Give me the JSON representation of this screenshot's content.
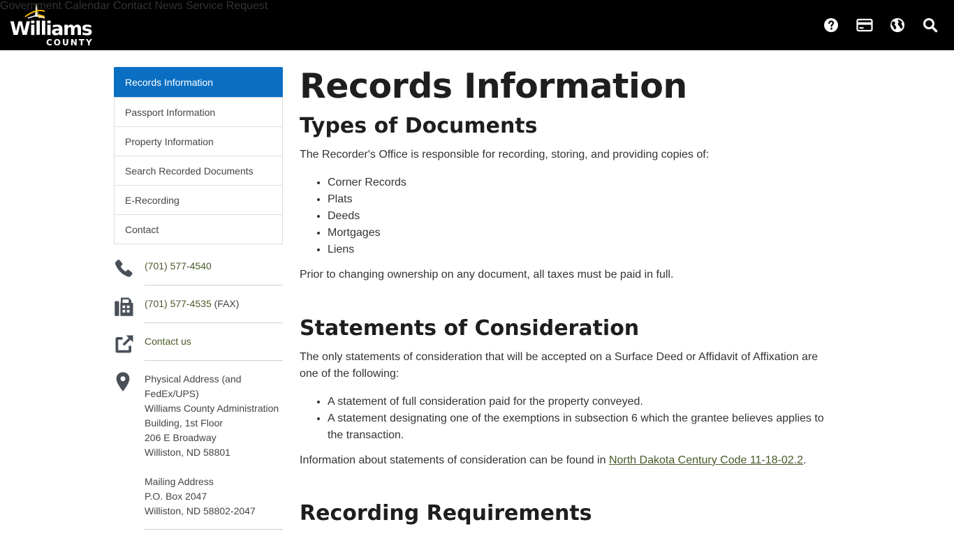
{
  "header": {
    "logo_word": "Williams",
    "logo_county": "COUNTY",
    "nav": [
      "Government",
      "Calendar",
      "Contact",
      "News",
      "Service Request"
    ],
    "icons": [
      "help-icon",
      "payment-card-icon",
      "globe-icon",
      "search-icon"
    ]
  },
  "sidebar": {
    "items": [
      {
        "label": "Records Information",
        "active": true
      },
      {
        "label": "Passport Information"
      },
      {
        "label": "Property Information"
      },
      {
        "label": "Search Recorded Documents"
      },
      {
        "label": "E-Recording"
      },
      {
        "label": "Contact"
      }
    ],
    "contact": {
      "phone": "(701) 577-4540",
      "fax": "(701) 577-4535",
      "fax_suffix": " (FAX)",
      "contact_link": "Contact us",
      "address_lines": [
        "Physical Address (and",
        "FedEx/UPS)",
        "Williams County Administration",
        "Building, 1st Floor",
        "206 E Broadway",
        "Williston, ND 58801",
        "",
        "Mailing Address",
        "P.O. Box 2047",
        "Williston, ND 58802-2047"
      ]
    }
  },
  "main": {
    "title": "Records Information",
    "types": {
      "heading": "Types of Documents",
      "intro": "The Recorder's Office is responsible for recording, storing, and providing copies of:",
      "items": [
        "Corner Records",
        "Plats",
        "Deeds",
        "Mortgages",
        "Liens"
      ],
      "note": "Prior to changing ownership on any document, all taxes must be paid in full."
    },
    "statements": {
      "heading": "Statements of Consideration",
      "intro": "The only statements of consideration that will be accepted on a Surface Deed or Affidavit of Affixation are one of the following:",
      "items": [
        "A statement of full consideration paid for the property conveyed.",
        "A statement designating one of the exemptions in subsection 6 which the grantee believes applies to the transaction."
      ],
      "info_prefix": "Information about statements of consideration can be found in ",
      "info_link": "North Dakota Century Code 11-18-02.2",
      "info_suffix": "."
    },
    "requirements": {
      "heading": "Recording Requirements"
    }
  },
  "colors": {
    "header_bg": "#000000",
    "active_nav": "#0a6fc2",
    "link": "#4a5a2a",
    "icon": "#4a5058",
    "logo_star": "#f2b705"
  }
}
